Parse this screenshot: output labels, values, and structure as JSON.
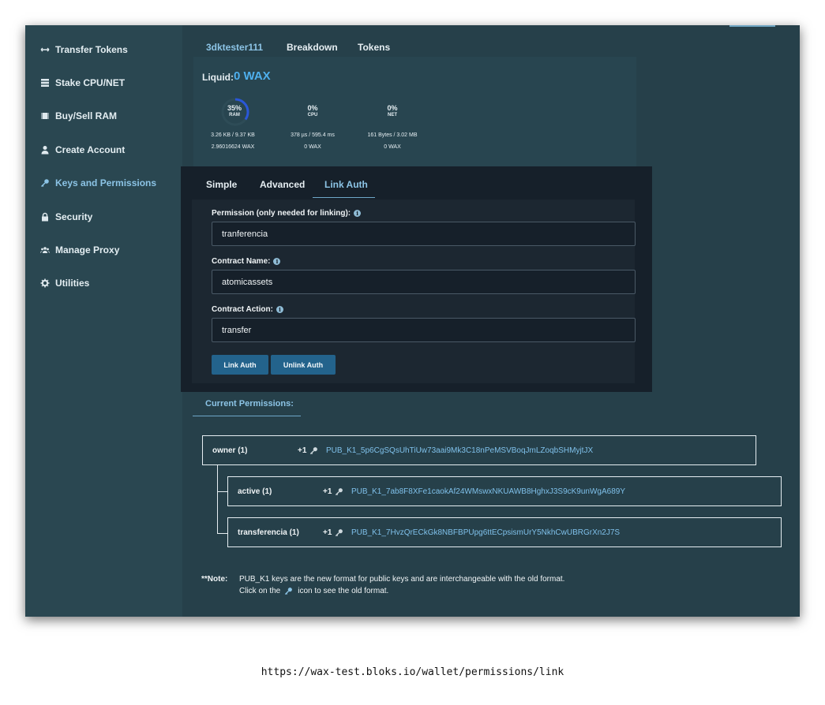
{
  "sidebar": {
    "items": [
      {
        "label": "Transfer Tokens",
        "icon": "transfer-arrows-icon"
      },
      {
        "label": "Stake CPU/NET",
        "icon": "server-stack-icon"
      },
      {
        "label": "Buy/Sell RAM",
        "icon": "memory-chip-icon"
      },
      {
        "label": "Create Account",
        "icon": "user-icon"
      },
      {
        "label": "Keys and Permissions",
        "icon": "key-icon"
      },
      {
        "label": "Security",
        "icon": "lock-icon"
      },
      {
        "label": "Manage Proxy",
        "icon": "users-group-icon"
      },
      {
        "label": "Utilities",
        "icon": "gear-icon"
      }
    ],
    "active_index": 4
  },
  "top_tabs": {
    "account": "3dktester111",
    "breakdown": "Breakdown",
    "tokens": "Tokens"
  },
  "liquid": {
    "label": "Liquid:",
    "value": "0 WAX"
  },
  "resources": {
    "ram": {
      "pct": "35%",
      "label": "RAM",
      "usage": "3.26 KB / 9.37 KB",
      "staked": "2.96016624 WAX",
      "fraction": 0.35
    },
    "cpu": {
      "pct": "0%",
      "label": "CPU",
      "usage": "378 µs / 595.4 ms",
      "staked": "0 WAX",
      "fraction": 0
    },
    "net": {
      "pct": "0%",
      "label": "NET",
      "usage": "161 Bytes / 3.02 MB",
      "staked": "0 WAX",
      "fraction": 0
    }
  },
  "sub_tabs": {
    "simple": "Simple",
    "advanced": "Advanced",
    "link_auth": "Link Auth"
  },
  "form": {
    "permission_label": "Permission (only needed for linking):",
    "permission_value": "tranferencia",
    "contract_label": "Contract Name:",
    "contract_value": "atomicassets",
    "action_label": "Contract Action:",
    "action_value": "transfer",
    "link_button": "Link Auth",
    "unlink_button": "Unlink Auth"
  },
  "permissions": {
    "title": "Current Permissions:",
    "owner": {
      "name": "owner (1)",
      "weight": "+1",
      "key": "PUB_K1_5p6CgSQsUhTiUw73aai9Mk3C18nPeMSVBoqJmLZoqbSHMyjtJX"
    },
    "active": {
      "name": "active (1)",
      "weight": "+1",
      "key": "PUB_K1_7ab8F8XFe1caokAf24WMswxNKUAWB8HghxJ3S9cK9unWgA689Y"
    },
    "transferencia": {
      "name": "transferencia (1)",
      "weight": "+1",
      "key": "PUB_K1_7HvzQrECkGk8NBFBPUpg6ttECpsismUrY5NkhCwUBRGrXn2J7S"
    }
  },
  "note": {
    "label": "**Note:",
    "line1": "PUB_K1 keys are the new format for public keys and are interchangeable with the old format.",
    "line2_before": "Click on the",
    "line2_after": "icon to see the old format."
  },
  "url": "https://wax-test.bloks.io/wallet/permissions/link",
  "colors": {
    "accent": "#8cc4e6",
    "key_link": "#7fc0ea",
    "liquid": "#4fb0ee",
    "button": "#23638c",
    "ram_ring": "#2a57d8"
  }
}
